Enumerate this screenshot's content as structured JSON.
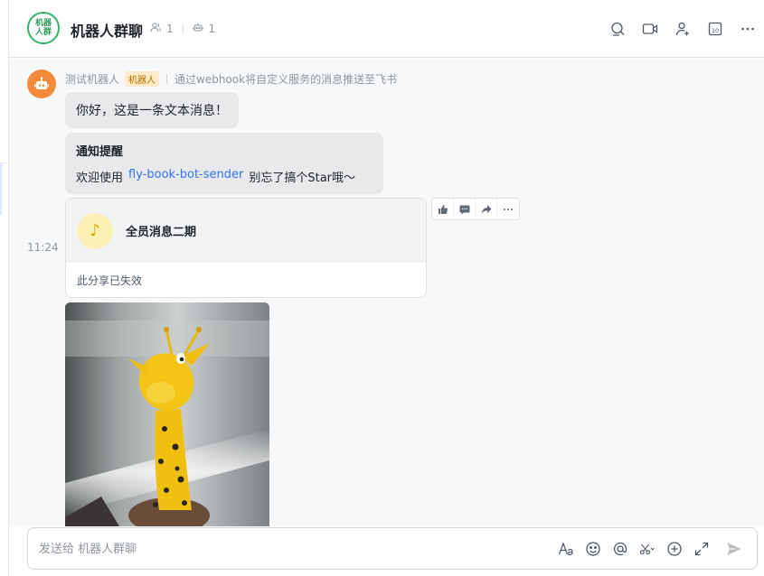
{
  "chat": {
    "avatar_text_1": "机器",
    "avatar_text_2": "人群",
    "title": "机器人群聊",
    "member_count": "1",
    "bot_count": "1"
  },
  "header_actions": [
    "search-icon",
    "video-icon",
    "add-member-icon",
    "calendar-icon",
    "more-icon"
  ],
  "message": {
    "sender_name": "测试机器人",
    "bot_tag": "机器人",
    "sender_desc": "通过webhook将自定义服务的消息推送至飞书",
    "text1": "你好，这是一条文本消息！",
    "post_title": "通知提醒",
    "post_prefix": "欢迎使用",
    "post_link": "fly-book-bot-sender",
    "post_suffix": "别忘了搞个Star哦～",
    "share_title": "全员消息二期",
    "share_status": "此分享已失效",
    "time": "11:24"
  },
  "composer": {
    "placeholder": "发送给 机器人群聊"
  },
  "colors": {
    "accent": "#3370ff",
    "bot_avatar": "#f7893b",
    "group_avatar_border": "#34b36b"
  }
}
